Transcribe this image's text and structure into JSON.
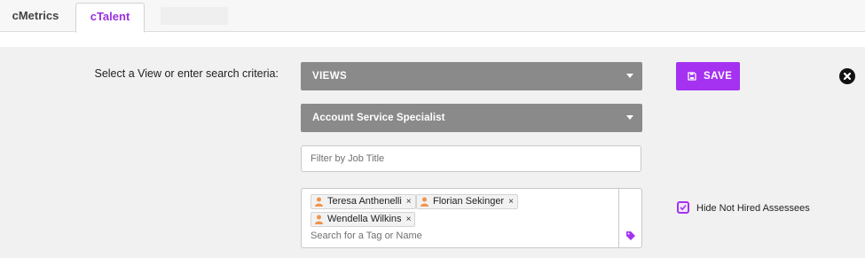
{
  "tabs": [
    {
      "label": "cMetrics",
      "active": false
    },
    {
      "label": "cTalent",
      "active": true
    }
  ],
  "search": {
    "prompt": "Select a View or enter search criteria:",
    "views_dropdown": "VIEWS",
    "role_dropdown": "Account Service Specialist",
    "job_title_placeholder": "Filter by Job Title",
    "tag_search_placeholder": "Search for a Tag or Name",
    "selected_people": [
      {
        "name": "Teresa Anthenelli",
        "remove": "×"
      },
      {
        "name": "Florian Sekinger",
        "remove": "×"
      },
      {
        "name": "Wendella Wilkins",
        "remove": "×"
      }
    ]
  },
  "actions": {
    "save_label": "SAVE"
  },
  "options": {
    "hide_not_hired_label": "Hide Not Hired Assessees",
    "hide_not_hired_checked": true
  },
  "colors": {
    "accent": "#a432f0",
    "dropdown_bg": "#8a8a8a",
    "panel_bg": "#f1f1f1",
    "person_icon": "#f0934a"
  },
  "icons": {
    "save": "floppy-disk-icon",
    "close": "close-circle-icon",
    "person": "person-icon",
    "tag": "tag-icon",
    "check": "checkmark-icon",
    "caret": "chevron-down-icon"
  }
}
